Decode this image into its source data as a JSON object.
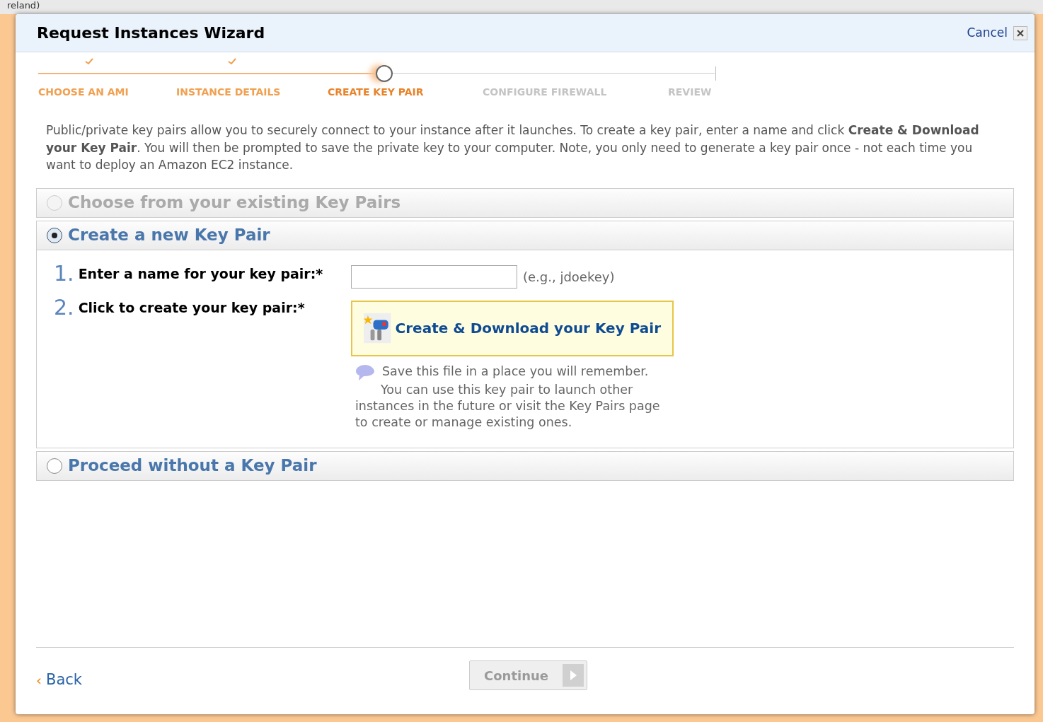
{
  "background": {
    "fragment": "reland)"
  },
  "window": {
    "title": "Request Instances Wizard",
    "cancel": "Cancel"
  },
  "steps": [
    {
      "label": "CHOOSE AN AMI",
      "done": true,
      "selected": false
    },
    {
      "label": "INSTANCE DETAILS",
      "done": true,
      "selected": false
    },
    {
      "label": "CREATE KEY PAIR",
      "done": false,
      "selected": true
    },
    {
      "label": "CONFIGURE FIREWALL",
      "done": false,
      "selected": false
    },
    {
      "label": "REVIEW",
      "done": false,
      "selected": false
    }
  ],
  "intro": "Public/private key pairs allow you to securely connect to your instance after it launches. To create a key pair, enter a name and click **Create & Download your Key Pair**. You will then be prompted to save the private key to your computer. Note, you only need to generate a key pair once - not each time you want to deploy an Amazon EC2 instance.",
  "options": [
    {
      "label": "Choose from your existing Key Pairs",
      "selected": false,
      "disabled": true
    },
    {
      "label": "Create a new Key Pair",
      "selected": true,
      "disabled": false
    },
    {
      "label": "Proceed without a Key Pair",
      "selected": false,
      "disabled": false
    }
  ],
  "form": {
    "step1": {
      "number": "1.",
      "label": "Enter a name for your key pair:*",
      "hint": "(e.g., jdoekey)"
    },
    "step2": {
      "number": "2.",
      "label": "Click to create your key pair:*",
      "button": "Create & Download your Key Pair"
    },
    "note_first": "Save this file in a place you will remember.",
    "note_rest": "You can use this key pair to launch other instances in the future or visit the Key Pairs page to create or manage existing ones."
  },
  "footer": {
    "back_arrow": "‹",
    "back": "Back",
    "continue": "Continue",
    "continue_disabled": true
  }
}
